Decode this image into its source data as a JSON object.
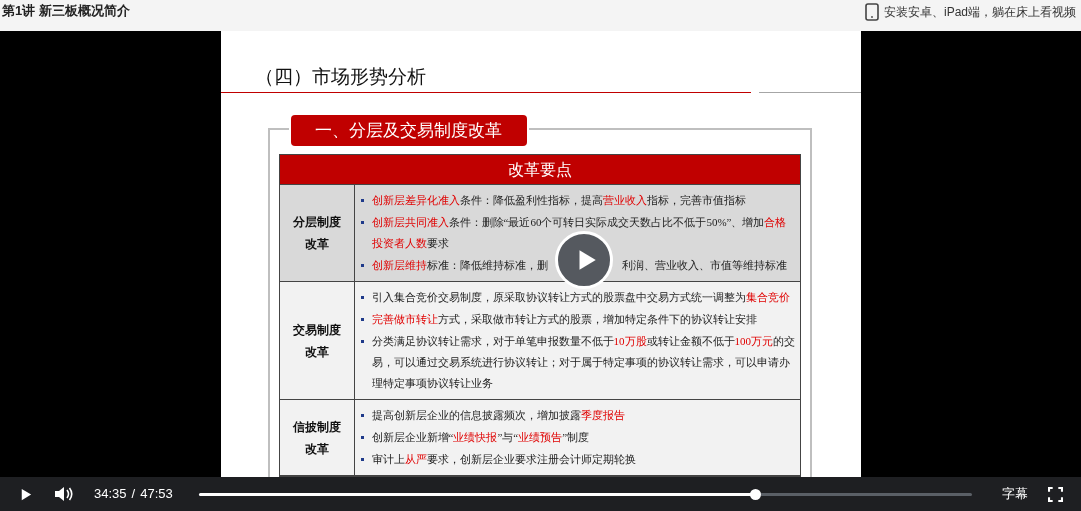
{
  "header": {
    "title": "第1讲 新三板概况简介",
    "promo": "安装安卓、iPad端，躺在床上看视频"
  },
  "slide": {
    "title": "（四）市场形势分析",
    "section_tab": "一、分层及交易制度改革",
    "table_header": "改革要点",
    "rows": [
      {
        "label": "分层制度改革",
        "shaded": true,
        "lines": [
          {
            "parts": [
              [
                {
                  "text": "创新层差异化准入",
                  "red": true
                },
                {
                  "text": "条件：降低盈利性指标，提高",
                  "red": false
                },
                {
                  "text": "营业收入",
                  "red": true
                },
                {
                  "text": "指标，完善市值指标",
                  "red": false
                }
              ]
            ]
          },
          {
            "parts": [
              [
                {
                  "text": "创新层共同准入",
                  "red": true
                },
                {
                  "text": "条件：删除“最近60个可转日实际成交天数占比不低于50%”、增加",
                  "red": false
                },
                {
                  "text": "合格投资者人数",
                  "red": true
                },
                {
                  "text": "要求",
                  "red": false
                }
              ]
            ]
          },
          {
            "parts": [
              [
                {
                  "text": "创新层维持",
                  "red": true
                },
                {
                  "text": "标准：降低维持标准，删",
                  "red": false
                }
              ],
              [
                {
                  "text": "利润、营业收入、市值等维持标准",
                  "red": false
                }
              ]
            ]
          }
        ]
      },
      {
        "label": "交易制度改革",
        "shaded": false,
        "lines": [
          {
            "parts": [
              [
                {
                  "text": "引入集合竞价交易制度，原采取协议转让方式的股票盘中交易方式统一调整为",
                  "red": false
                },
                {
                  "text": "集合竞价",
                  "red": true
                }
              ]
            ]
          },
          {
            "parts": [
              [
                {
                  "text": "完善做市转让",
                  "red": true
                },
                {
                  "text": "方式，采取做市转让方式的股票，增加特定条件下的协议转让安排",
                  "red": false
                }
              ]
            ]
          },
          {
            "parts": [
              [
                {
                  "text": "分类满足协议转让需求，对于单笔申报数量不低于",
                  "red": false
                },
                {
                  "text": "10万股",
                  "red": true
                },
                {
                  "text": "或转让金额不低于",
                  "red": false
                },
                {
                  "text": "100万元",
                  "red": true
                },
                {
                  "text": "的交易，可以通过交易系统进行协议转让；对于属于特定事项的协议转让需求，可以申请办理特定事项协议转让业务",
                  "red": false
                }
              ]
            ]
          }
        ]
      },
      {
        "label": "信披制度改革",
        "shaded": false,
        "lines": [
          {
            "parts": [
              [
                {
                  "text": "提高创新层企业的信息披露频次，增加披露",
                  "red": false
                },
                {
                  "text": "季度报告",
                  "red": true
                }
              ]
            ]
          },
          {
            "parts": [
              [
                {
                  "text": "创新层企业新增“",
                  "red": false
                },
                {
                  "text": "业绩快报",
                  "red": true
                },
                {
                  "text": "”与“",
                  "red": false
                },
                {
                  "text": "业绩预告",
                  "red": true
                },
                {
                  "text": "”制度",
                  "red": false
                }
              ]
            ]
          },
          {
            "parts": [
              [
                {
                  "text": "审计上",
                  "red": false
                },
                {
                  "text": "从严",
                  "red": true
                },
                {
                  "text": "要求，创新层企业要求注册会计师定期轮换",
                  "red": false
                }
              ]
            ]
          }
        ]
      }
    ]
  },
  "player": {
    "playing": false,
    "current": "34:35",
    "separator": "/",
    "duration": "47:53",
    "level": 0.72,
    "subtitles": "字幕"
  }
}
